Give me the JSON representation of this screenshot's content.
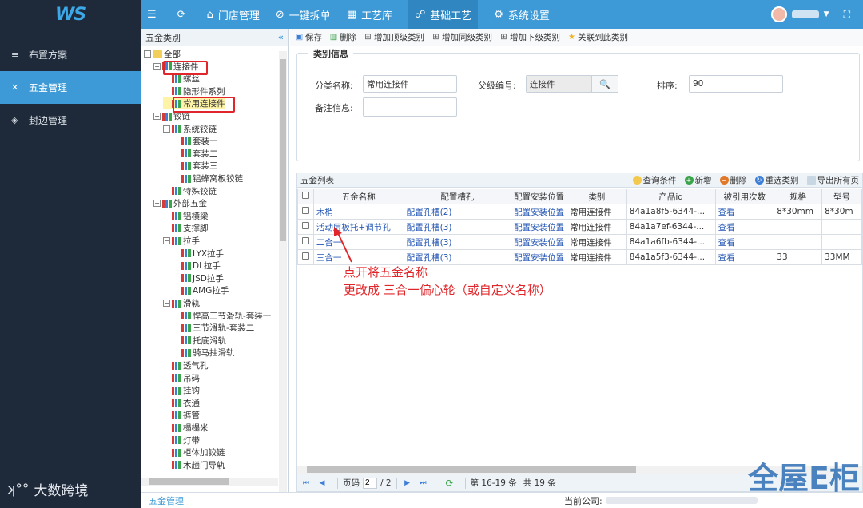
{
  "header": {
    "logo": "WS",
    "nav": [
      {
        "icon": "☰",
        "label": ""
      },
      {
        "icon": "⟳",
        "label": ""
      },
      {
        "icon": "⌂",
        "label": "门店管理"
      },
      {
        "icon": "⊘",
        "label": "一键拆单"
      },
      {
        "icon": "▦",
        "label": "工艺库"
      },
      {
        "icon": "☍",
        "label": "基础工艺"
      },
      {
        "icon": "⚙",
        "label": "系统设置"
      }
    ]
  },
  "sidebar": {
    "items": [
      {
        "icon": "≡",
        "label": "布置方案"
      },
      {
        "icon": "✕",
        "label": "五金管理"
      },
      {
        "icon": "◈",
        "label": "封边管理"
      }
    ],
    "watermark": "大数跨境"
  },
  "tree_panel": {
    "title": "五金类别",
    "collapse": "«",
    "nodes": [
      {
        "label": "全部",
        "level": 0,
        "toggle": "−",
        "icon": "folder"
      },
      {
        "label": "连接件",
        "level": 1,
        "toggle": "−",
        "icon": "bars"
      },
      {
        "label": "螺丝",
        "level": 2,
        "toggle": "",
        "icon": "bars"
      },
      {
        "label": "隐形件系列",
        "level": 2,
        "toggle": "",
        "icon": "bars"
      },
      {
        "label": "常用连接件",
        "level": 2,
        "toggle": "",
        "icon": "bars"
      },
      {
        "label": "铰链",
        "level": 1,
        "toggle": "−",
        "icon": "bars"
      },
      {
        "label": "系统铰链",
        "level": 2,
        "toggle": "−",
        "icon": "bars"
      },
      {
        "label": "套装一",
        "level": 3,
        "toggle": "",
        "icon": "bars"
      },
      {
        "label": "套装二",
        "level": 3,
        "toggle": "",
        "icon": "bars"
      },
      {
        "label": "套装三",
        "level": 3,
        "toggle": "",
        "icon": "bars"
      },
      {
        "label": "铝蜂窝板铰链",
        "level": 3,
        "toggle": "",
        "icon": "bars"
      },
      {
        "label": "特殊铰链",
        "level": 2,
        "toggle": "",
        "icon": "bars"
      },
      {
        "label": "外部五金",
        "level": 1,
        "toggle": "−",
        "icon": "bars"
      },
      {
        "label": "铝横梁",
        "level": 2,
        "toggle": "",
        "icon": "bars"
      },
      {
        "label": "支撑脚",
        "level": 2,
        "toggle": "",
        "icon": "bars"
      },
      {
        "label": "拉手",
        "level": 2,
        "toggle": "−",
        "icon": "bars"
      },
      {
        "label": "LYX拉手",
        "level": 3,
        "toggle": "",
        "icon": "bars"
      },
      {
        "label": "DL拉手",
        "level": 3,
        "toggle": "",
        "icon": "bars"
      },
      {
        "label": "JSD拉手",
        "level": 3,
        "toggle": "",
        "icon": "bars"
      },
      {
        "label": "AMG拉手",
        "level": 3,
        "toggle": "",
        "icon": "bars"
      },
      {
        "label": "滑轨",
        "level": 2,
        "toggle": "−",
        "icon": "bars"
      },
      {
        "label": "悍高三节滑轨-套装一",
        "level": 3,
        "toggle": "",
        "icon": "bars"
      },
      {
        "label": "三节滑轨-套装二",
        "level": 3,
        "toggle": "",
        "icon": "bars"
      },
      {
        "label": "托底滑轨",
        "level": 3,
        "toggle": "",
        "icon": "bars"
      },
      {
        "label": "骑马抽滑轨",
        "level": 3,
        "toggle": "",
        "icon": "bars"
      },
      {
        "label": "透气孔",
        "level": 2,
        "toggle": "",
        "icon": "bars"
      },
      {
        "label": "吊码",
        "level": 2,
        "toggle": "",
        "icon": "bars"
      },
      {
        "label": "挂钩",
        "level": 2,
        "toggle": "",
        "icon": "bars"
      },
      {
        "label": "衣通",
        "level": 2,
        "toggle": "",
        "icon": "bars"
      },
      {
        "label": "裤管",
        "level": 2,
        "toggle": "",
        "icon": "bars"
      },
      {
        "label": "榻榻米",
        "level": 2,
        "toggle": "",
        "icon": "bars"
      },
      {
        "label": "灯带",
        "level": 2,
        "toggle": "",
        "icon": "bars"
      },
      {
        "label": "柜体加铰链",
        "level": 2,
        "toggle": "",
        "icon": "bars"
      },
      {
        "label": "木趟门导轨",
        "level": 2,
        "toggle": "",
        "icon": "bars"
      }
    ]
  },
  "toolbar": {
    "buttons": [
      {
        "icon": "▣",
        "label": "保存"
      },
      {
        "icon": "▥",
        "label": "删除"
      },
      {
        "icon": "⊞",
        "label": "增加顶级类别"
      },
      {
        "icon": "⊞",
        "label": "增加同级类别"
      },
      {
        "icon": "⊞",
        "label": "增加下级类别"
      },
      {
        "icon": "★",
        "label": "关联到此类别"
      }
    ]
  },
  "category_info": {
    "legend": "类别信息",
    "name_label": "分类名称:",
    "name_value": "常用连接件",
    "parent_label": "父级编号:",
    "parent_value": "连接件",
    "sort_label": "排序:",
    "sort_value": "90",
    "remark_label": "备注信息:",
    "remark_value": ""
  },
  "grid": {
    "title": "五金列表",
    "tools": [
      {
        "label": "查询条件",
        "color": "#f2c94c",
        "icon": ""
      },
      {
        "label": "新增",
        "color": "#3ca44a",
        "icon": "+"
      },
      {
        "label": "删除",
        "color": "#e07a2a",
        "icon": "−"
      },
      {
        "label": "重选类别",
        "color": "#3d7fd6",
        "icon": "↻"
      },
      {
        "label": "导出所有页",
        "color": "#8aa0b8",
        "icon": ""
      }
    ],
    "columns": [
      "五金名称",
      "配置槽孔",
      "配置安装位置",
      "类别",
      "产品id",
      "被引用次数",
      "规格",
      "型号"
    ],
    "rows": [
      [
        "木梢",
        "配置孔槽(2)",
        "配置安装位置",
        "常用连接件",
        "84a1a8f5-6344-...",
        "查看",
        "8*30mm",
        "8*30m"
      ],
      [
        "活动层板托+调节孔",
        "配置孔槽(3)",
        "配置安装位置",
        "常用连接件",
        "84a1a7ef-6344-...",
        "查看",
        "",
        ""
      ],
      [
        "二合一",
        "配置孔槽(3)",
        "配置安装位置",
        "常用连接件",
        "84a1a6fb-6344-...",
        "查看",
        "",
        ""
      ],
      [
        "三合一",
        "配置孔槽(3)",
        "配置安装位置",
        "常用连接件",
        "84a1a5f3-6344-...",
        "查看",
        "33",
        "33MM"
      ]
    ],
    "annotation_line1": "点开将五金名称",
    "annotation_line2": "更改成 三合一偏心轮（或自定义名称）"
  },
  "pager": {
    "page_label": "页码",
    "page_value": "2",
    "total_pages": "/ 2",
    "range_text": "第 16-19 条",
    "total_text": "共 19 条"
  },
  "footer": {
    "crumb": "五金管理",
    "company_label": "当前公司:"
  },
  "watermark_right": "全屋E柜",
  "colors": {
    "accent": "#3d9ad6",
    "sidebar": "#1e2a3a",
    "highlight": "#e0262a"
  }
}
